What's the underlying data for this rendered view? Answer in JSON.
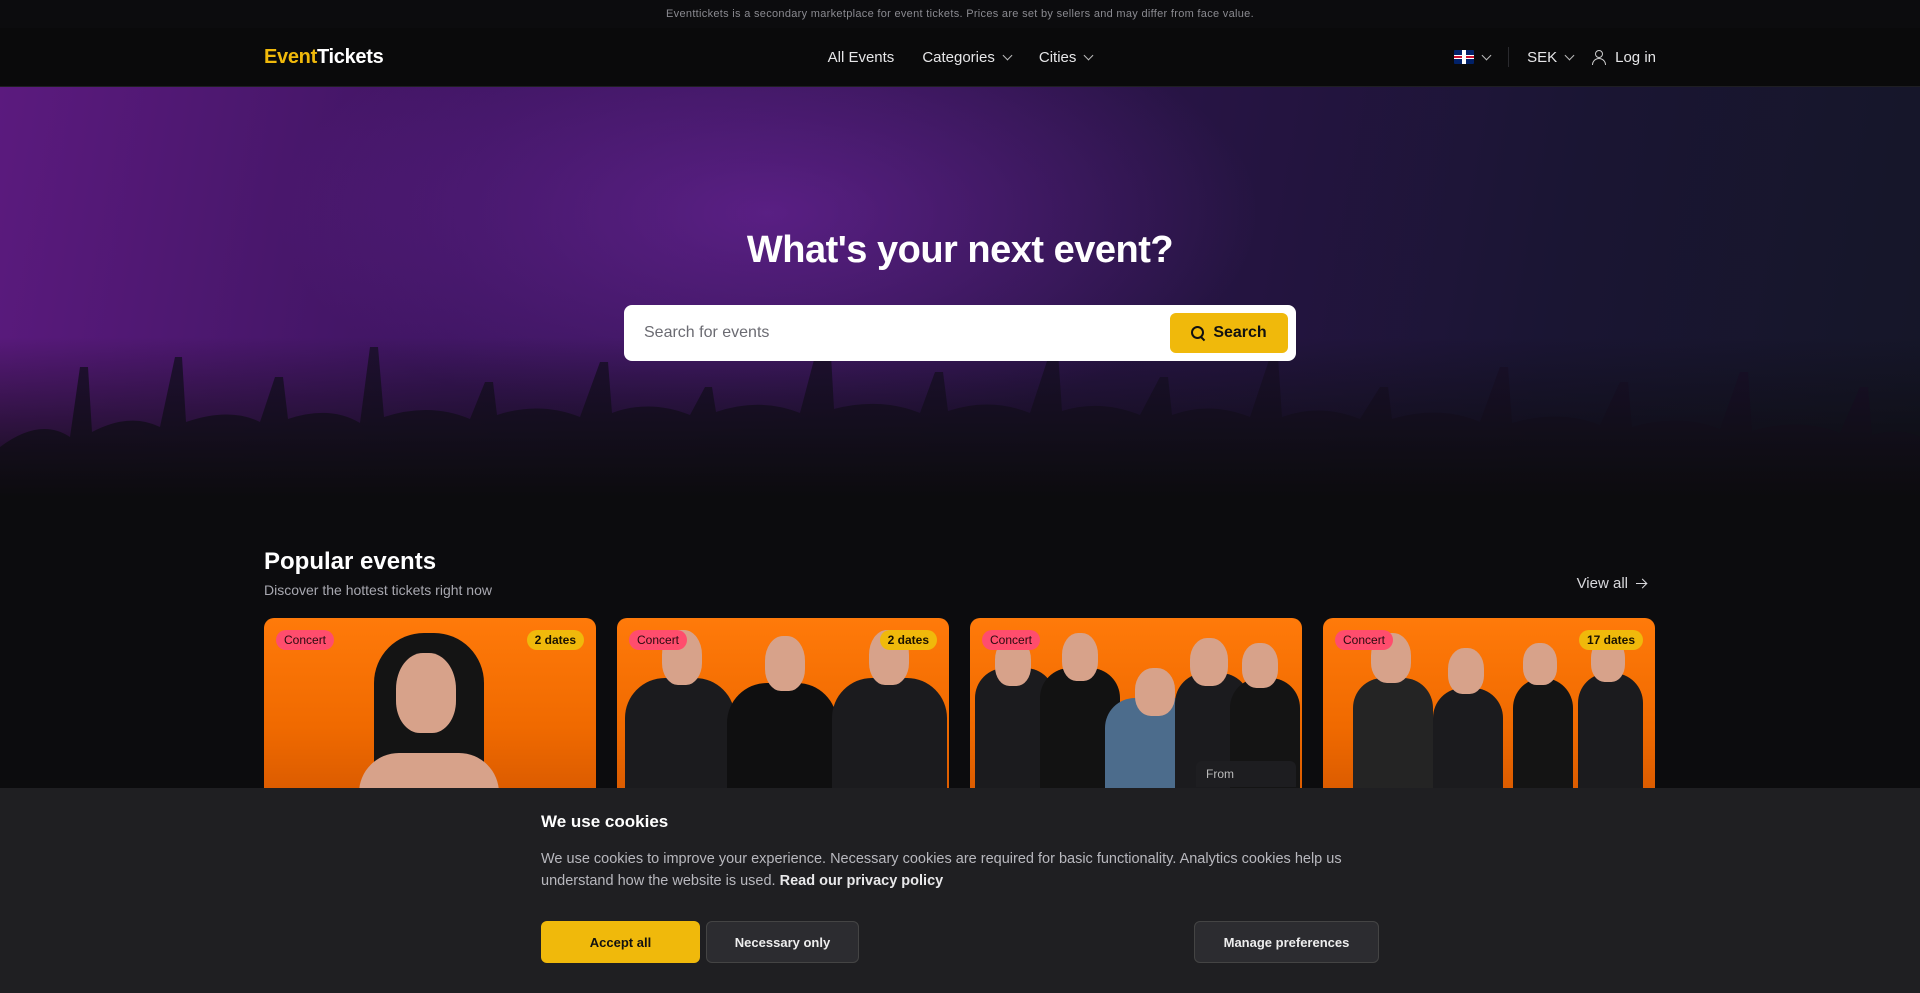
{
  "notice": "Eventtickets is a secondary marketplace for event tickets. Prices are set by sellers and may differ from face value.",
  "logo": {
    "part1": "Event",
    "part2": "Tickets"
  },
  "nav": {
    "all_events": "All Events",
    "categories": "Categories",
    "cities": "Cities"
  },
  "header_right": {
    "language_flag": "uk-flag-icon",
    "currency": "SEK",
    "login": "Log in"
  },
  "hero": {
    "title": "What's your next event?",
    "search_placeholder": "Search for events",
    "search_button": "Search"
  },
  "popular": {
    "title": "Popular events",
    "subtitle": "Discover the hottest tickets right now",
    "view_all": "View all",
    "cards": [
      {
        "category": "Concert",
        "dates": "2 dates"
      },
      {
        "category": "Concert",
        "dates": "2 dates"
      },
      {
        "category": "Concert",
        "dates": "",
        "price_label": "From"
      },
      {
        "category": "Concert",
        "dates": "17 dates"
      }
    ]
  },
  "cookie": {
    "title": "We use cookies",
    "text": "We use cookies to improve your experience. Necessary cookies are required for basic functionality. Analytics cookies help us understand how the website is used.",
    "privacy_link": "Read our privacy policy",
    "accept_all": "Accept all",
    "necessary_only": "Necessary only",
    "manage": "Manage preferences"
  },
  "colors": {
    "accent": "#f0b90b",
    "category_badge": "#ff4d6d",
    "card_bg": "#f06a00"
  }
}
